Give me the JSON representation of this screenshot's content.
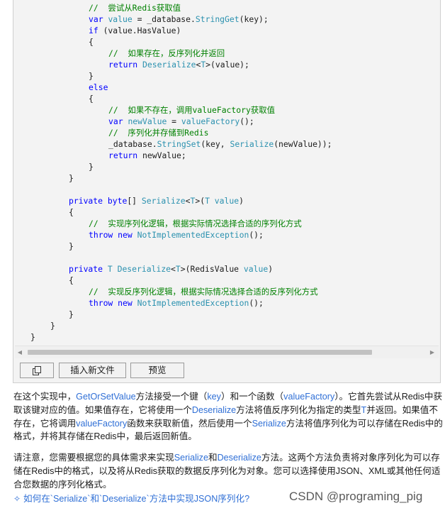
{
  "code": {
    "lines": [
      [
        [
          "//  尝试从Redis获取值",
          "c"
        ]
      ],
      [
        [
          "var ",
          "k"
        ],
        [
          "value",
          "t"
        ],
        [
          " = _database.",
          "p"
        ],
        [
          "StringGet",
          "t"
        ],
        [
          "(key);",
          "p"
        ]
      ],
      [
        [
          "if ",
          "k"
        ],
        [
          "(value.HasValue)",
          "p"
        ]
      ],
      [
        [
          "{",
          "p"
        ]
      ],
      [
        [
          "//  如果存在，反序列化并返回",
          "c"
        ]
      ],
      [
        [
          "return ",
          "k"
        ],
        [
          "Deserialize",
          "t"
        ],
        [
          "<",
          "p"
        ],
        [
          "T",
          "t"
        ],
        [
          ">(value);",
          "p"
        ]
      ],
      [
        [
          "}",
          "p"
        ]
      ],
      [
        [
          "else",
          "k"
        ]
      ],
      [
        [
          "{",
          "p"
        ]
      ],
      [
        [
          "//  如果不存在，调用valueFactory获取值",
          "c"
        ]
      ],
      [
        [
          "var ",
          "k"
        ],
        [
          "newValue",
          "t"
        ],
        [
          " = ",
          "p"
        ],
        [
          "valueFactory",
          "t"
        ],
        [
          "();",
          "p"
        ]
      ],
      [
        [
          "//  序列化并存储到Redis",
          "c"
        ]
      ],
      [
        [
          "_database.",
          "p"
        ],
        [
          "StringSet",
          "t"
        ],
        [
          "(key, ",
          "p"
        ],
        [
          "Serialize",
          "t"
        ],
        [
          "(newValue));",
          "p"
        ]
      ],
      [
        [
          "return ",
          "k"
        ],
        [
          "newValue;",
          "p"
        ]
      ],
      [
        [
          "}",
          "p"
        ]
      ],
      [
        [
          "}",
          "p"
        ]
      ],
      [],
      [
        [
          "private ",
          "k"
        ],
        [
          "byte",
          "k"
        ],
        [
          "[] ",
          "p"
        ],
        [
          "Serialize",
          "t"
        ],
        [
          "<",
          "p"
        ],
        [
          "T",
          "t"
        ],
        [
          ">(",
          "p"
        ],
        [
          "T ",
          "t"
        ],
        [
          "value",
          "t"
        ],
        [
          ")",
          "p"
        ]
      ],
      [
        [
          "{",
          "p"
        ]
      ],
      [
        [
          "//  实现序列化逻辑，根据实际情况选择合适的序列化方式",
          "c"
        ]
      ],
      [
        [
          "throw ",
          "k"
        ],
        [
          "new ",
          "k"
        ],
        [
          "NotImplementedException",
          "t"
        ],
        [
          "();",
          "p"
        ]
      ],
      [
        [
          "}",
          "p"
        ]
      ],
      [],
      [
        [
          "private ",
          "k"
        ],
        [
          "T ",
          "t"
        ],
        [
          "Deserialize",
          "t"
        ],
        [
          "<",
          "p"
        ],
        [
          "T",
          "t"
        ],
        [
          ">(RedisValue ",
          "p"
        ],
        [
          "value",
          "t"
        ],
        [
          ")",
          "p"
        ]
      ],
      [
        [
          "{",
          "p"
        ]
      ],
      [
        [
          "//  实现反序列化逻辑，根据实际情况选择合适的反序列化方式",
          "c"
        ]
      ],
      [
        [
          "throw ",
          "k"
        ],
        [
          "new ",
          "k"
        ],
        [
          "NotImplementedException",
          "t"
        ],
        [
          "();",
          "p"
        ]
      ],
      [
        [
          "}",
          "p"
        ]
      ],
      [
        [
          "}",
          "p"
        ]
      ],
      [
        [
          "}",
          "p"
        ]
      ]
    ]
  },
  "toolbar": {
    "copy_icon": "copy-icon",
    "insert_label": "插入新文件",
    "preview_label": "预览"
  },
  "explanation": {
    "paragraph1": [
      [
        "在这个实现中，",
        ""
      ],
      [
        "GetOrSetValue",
        "hl"
      ],
      [
        "方法接受一个键（",
        ""
      ],
      [
        "key",
        "hl"
      ],
      [
        "）和一个函数（",
        ""
      ],
      [
        "valueFactory",
        "hl"
      ],
      [
        "）。它首先尝试从Redis中获取该键对应的值。如果值存在，它将使用一个",
        ""
      ],
      [
        "Deserialize",
        "hl"
      ],
      [
        "方法将值反序列化为指定的类型",
        ""
      ],
      [
        "T",
        "hl"
      ],
      [
        "并返回。如果值不存在，它将调用",
        ""
      ],
      [
        "valueFactory",
        "hl"
      ],
      [
        "函数来获取新值，然后使用一个",
        ""
      ],
      [
        "Serialize",
        "hl"
      ],
      [
        "方法将值序列化为可以存储在Redis中的格式，并将其存储在Redis中，最后返回新值。",
        ""
      ]
    ],
    "paragraph2": [
      [
        "请注意，您需要根据您的具体需求来实现",
        ""
      ],
      [
        "Serialize",
        "hl"
      ],
      [
        "和",
        ""
      ],
      [
        "Deserialize",
        "hl"
      ],
      [
        "方法。这两个方法负责将对象序列化为可以存储在Redis中的格式，以及将从Redis获取的数据反序列化为对象。您可以选择使用JSON、XML或其他任何适合您数据的序列化格式。",
        ""
      ]
    ]
  },
  "suggestion": {
    "icon": "sparkle-icon",
    "text": "如何在`Serialize`和`Deserialize`方法中实现JSON序列化?"
  },
  "watermark": {
    "text": "CSDN @programing_pig"
  }
}
